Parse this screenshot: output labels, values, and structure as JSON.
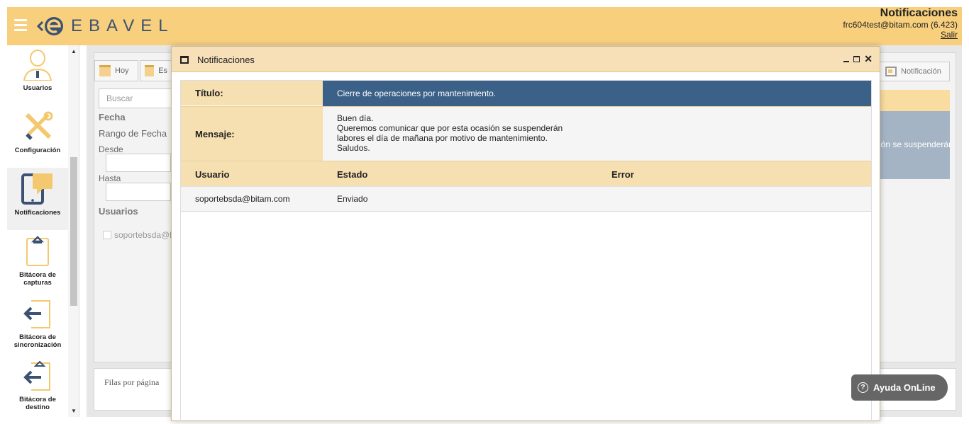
{
  "header": {
    "logo_text": "EBAVEL",
    "section_title": "Notificaciones",
    "user": "frc604test@bitam.com  (6.423)",
    "logout": "Salir"
  },
  "sidebar": {
    "items": [
      {
        "label": "Usuarios",
        "icon": "user-icon"
      },
      {
        "label": "Configuración",
        "icon": "tools-icon"
      },
      {
        "label": "Notificaciones",
        "icon": "tablet-chat-icon",
        "active": true
      },
      {
        "label": "Bitácora de capturas",
        "icon": "clipboard-icon"
      },
      {
        "label": "Bitácora de sincronización",
        "icon": "sync-log-icon"
      },
      {
        "label": "Bitácora de destino",
        "icon": "destination-log-icon"
      }
    ],
    "scroll_up": "▲",
    "scroll_down": "▼"
  },
  "background": {
    "toolbar": {
      "today": "Hoy",
      "second": "Es",
      "notification": "Notificación"
    },
    "search_placeholder": "Buscar",
    "filters": {
      "date_heading": "Fecha",
      "date_range": "Rango de Fecha",
      "from": "Desde",
      "to": "Hasta",
      "users_heading": "Usuarios",
      "user_option": "soportebsda@b"
    },
    "row_peek_text": "sión se suspenderán",
    "rows_per_page": "Filas por página"
  },
  "modal": {
    "title": "Notificaciones",
    "controls": {
      "minimize": "_",
      "maximize": "□",
      "close": "✕"
    },
    "title_label": "Título:",
    "title_value": "Cierre de operaciones por mantenimiento.",
    "message_label": "Mensaje:",
    "message_lines": [
      "Buen día.",
      "Queremos comunicar que por esta ocasión se suspenderán",
      "labores el día de mañana por motivo de mantenimiento.",
      "Saludos."
    ],
    "table": {
      "columns": [
        "Usuario",
        "Estado",
        "Error"
      ],
      "rows": [
        {
          "user": "soportebsda@bitam.com",
          "status": "Enviado",
          "error": ""
        }
      ]
    }
  },
  "help_button": {
    "label": "Ayuda OnLine",
    "icon_glyph": "?"
  },
  "colors": {
    "header_bg": "#f8cf7c",
    "modal_title_bg": "#f7e0b8",
    "title_value_bg": "#3c6188",
    "label_bg": "#f6dfb0",
    "brand_blue": "#3b5272"
  }
}
